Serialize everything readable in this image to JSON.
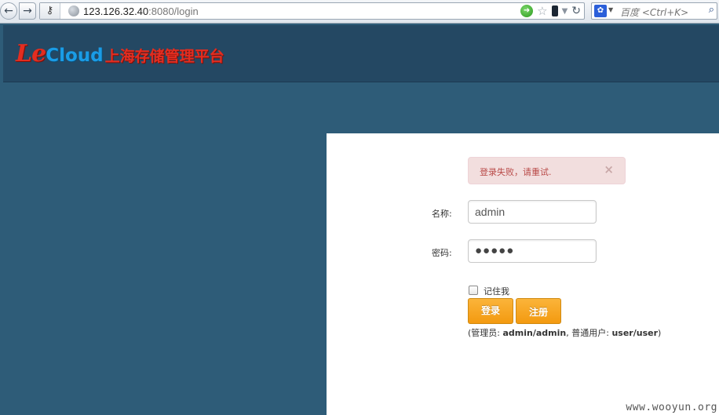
{
  "browser": {
    "url_host": "123.126.32.40",
    "url_rest": ":8080/login",
    "search_placeholder": "百度 <Ctrl+K>"
  },
  "header": {
    "logo_le": "Le",
    "logo_cloud": "Cloud",
    "logo_cn": "上海存储管理平台"
  },
  "login": {
    "alert_text": "登录失败，请重试.",
    "alert_close": "×",
    "name_label": "名称:",
    "name_value": "admin",
    "password_label": "密码:",
    "password_value": "●●●●●",
    "remember_label": "记住我",
    "login_button": "登录",
    "register_button": "注册",
    "hint_prefix": "(管理员: ",
    "hint_admin": "admin/admin",
    "hint_mid": ", 普通用户: ",
    "hint_user": "user/user",
    "hint_suffix": ")"
  },
  "watermark": "www.wooyun.org",
  "colors": {
    "background": "#2e5c78",
    "header": "#244863",
    "button": "#f7a823",
    "alert_bg": "#f2dede",
    "alert_text": "#b94a48"
  }
}
